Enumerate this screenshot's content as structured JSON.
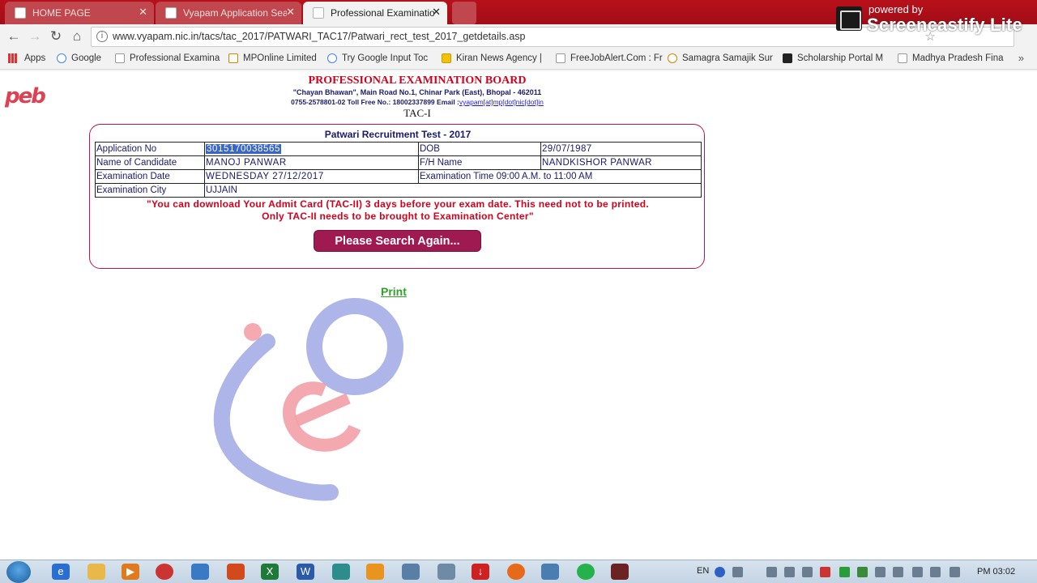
{
  "browser": {
    "tabs": [
      {
        "title": "HOME PAGE",
        "active": false
      },
      {
        "title": "Vyapam Application Sea",
        "active": false
      },
      {
        "title": "Professional Examination",
        "active": true
      }
    ],
    "url": "www.vyapam.nic.in/tacs/tac_2017/PATWARI_TAC17/Patwari_rect_test_2017_getdetails.asp",
    "bookmarks": [
      "Apps",
      "Google",
      "Professional Examina",
      "MPOnline Limited",
      "Try Google Input Toc",
      "Kiran News Agency |",
      "FreeJobAlert.Com : Fr",
      "Samagra Samajik Sur",
      "Scholarship Portal M",
      "Madhya Pradesh Fina"
    ],
    "more_bookmarks": "»"
  },
  "watermark": {
    "powered": "powered by",
    "name": "Screencastify Lite"
  },
  "header": {
    "logo": "peb",
    "title": "PROFESSIONAL EXAMINATION BOARD",
    "address": "\"Chayan Bhawan\", Main Road No.1, Chinar Park (East), Bhopal - 462011",
    "contact": "0755-2578801-02 Toll Free No.: 18002337899 Email :",
    "email": "vyapam[at]mp[dot]nic[dot]in",
    "tac": "TAC-I"
  },
  "panel": {
    "title": "Patwari Recruitment Test - 2017",
    "rows": [
      {
        "l1": "Application No",
        "v1": "3015170038565",
        "l2": "DOB",
        "v2": "29/07/1987"
      },
      {
        "l1": "Name of Candidate",
        "v1": "MANOJ PANWAR",
        "l2": "F/H Name",
        "v2": "NANDKISHOR PANWAR"
      },
      {
        "l1": "Examination Date",
        "v1": "WEDNESDAY 27/12/2017",
        "l2": "Examination Time 09:00 A.M. to 11:00 AM",
        "v2": ""
      },
      {
        "l1": "Examination City",
        "v1": "UJJAIN",
        "l2": "",
        "v2": ""
      }
    ],
    "notice_line1": "\"You can download Your Admit Card (TAC-II) 3 days before your exam date. This need not to be printed.",
    "notice_line2": "Only TAC-II needs to be brought to Examination Center\"",
    "search_again": "Please Search Again..."
  },
  "print_label": "Print",
  "taskbar": {
    "lang": "EN",
    "time": "PM 03:02"
  },
  "colors": {
    "title_red": "#d4001c",
    "navy": "#1a1a6e",
    "panel_border": "#b31651",
    "button": "#a01a52",
    "print_green": "#2fa32a",
    "tabstrip": "#b8101a"
  }
}
